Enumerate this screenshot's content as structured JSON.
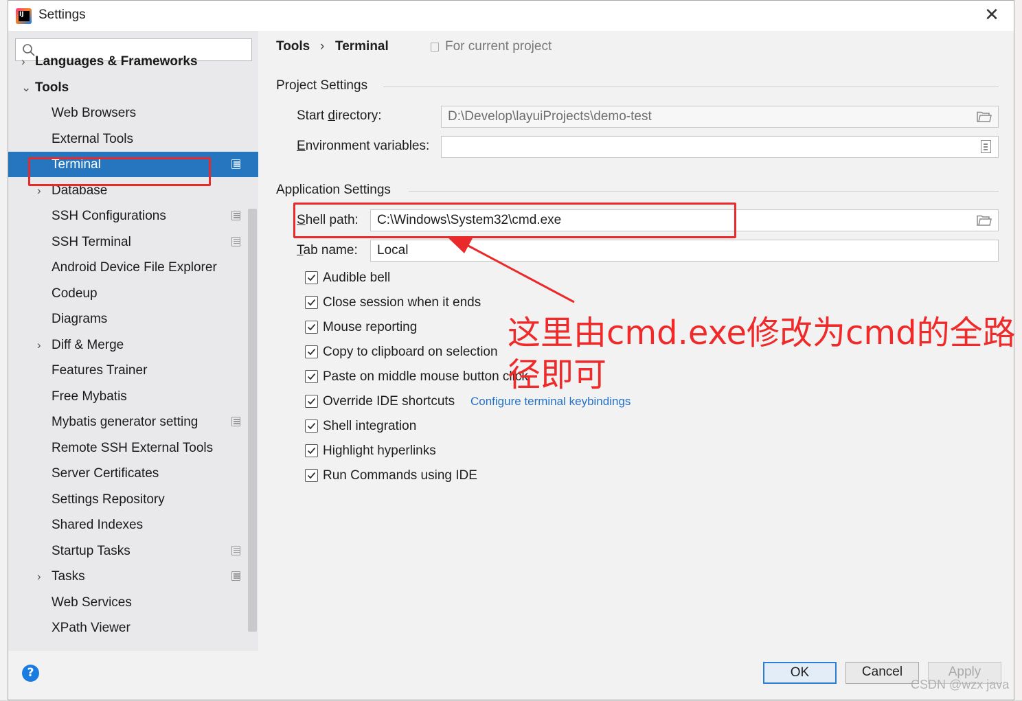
{
  "window": {
    "title": "Settings",
    "close_symbol": "✕"
  },
  "search": {
    "placeholder": ""
  },
  "sidebar": {
    "items": [
      {
        "label": "Languages & Frameworks",
        "level": 0,
        "chevron": "›",
        "project_scoped": false,
        "selected": false
      },
      {
        "label": "Tools",
        "level": 0,
        "chevron": "⌄",
        "project_scoped": false,
        "selected": false
      },
      {
        "label": "Web Browsers",
        "level": 1,
        "chevron": "",
        "project_scoped": false,
        "selected": false
      },
      {
        "label": "External Tools",
        "level": 1,
        "chevron": "",
        "project_scoped": false,
        "selected": false
      },
      {
        "label": "Terminal",
        "level": 1,
        "chevron": "",
        "project_scoped": true,
        "selected": true
      },
      {
        "label": "Database",
        "level": 1,
        "chevron": "›",
        "project_scoped": false,
        "selected": false
      },
      {
        "label": "SSH Configurations",
        "level": 1,
        "chevron": "",
        "project_scoped": true,
        "selected": false
      },
      {
        "label": "SSH Terminal",
        "level": 1,
        "chevron": "",
        "project_scoped": true,
        "selected": false
      },
      {
        "label": "Android Device File Explorer",
        "level": 1,
        "chevron": "",
        "project_scoped": false,
        "selected": false
      },
      {
        "label": "Codeup",
        "level": 1,
        "chevron": "",
        "project_scoped": false,
        "selected": false
      },
      {
        "label": "Diagrams",
        "level": 1,
        "chevron": "",
        "project_scoped": false,
        "selected": false
      },
      {
        "label": "Diff & Merge",
        "level": 1,
        "chevron": "›",
        "project_scoped": false,
        "selected": false
      },
      {
        "label": "Features Trainer",
        "level": 1,
        "chevron": "",
        "project_scoped": false,
        "selected": false
      },
      {
        "label": "Free Mybatis",
        "level": 1,
        "chevron": "",
        "project_scoped": false,
        "selected": false
      },
      {
        "label": "Mybatis generator setting",
        "level": 1,
        "chevron": "",
        "project_scoped": true,
        "selected": false
      },
      {
        "label": "Remote SSH External Tools",
        "level": 1,
        "chevron": "",
        "project_scoped": false,
        "selected": false
      },
      {
        "label": "Server Certificates",
        "level": 1,
        "chevron": "",
        "project_scoped": false,
        "selected": false
      },
      {
        "label": "Settings Repository",
        "level": 1,
        "chevron": "",
        "project_scoped": false,
        "selected": false
      },
      {
        "label": "Shared Indexes",
        "level": 1,
        "chevron": "",
        "project_scoped": false,
        "selected": false
      },
      {
        "label": "Startup Tasks",
        "level": 1,
        "chevron": "",
        "project_scoped": true,
        "selected": false
      },
      {
        "label": "Tasks",
        "level": 1,
        "chevron": "›",
        "project_scoped": true,
        "selected": false
      },
      {
        "label": "Web Services",
        "level": 1,
        "chevron": "",
        "project_scoped": false,
        "selected": false
      },
      {
        "label": "XPath Viewer",
        "level": 1,
        "chevron": "",
        "project_scoped": false,
        "selected": false
      }
    ]
  },
  "breadcrumb": {
    "parent": "Tools",
    "separator": "›",
    "current": "Terminal"
  },
  "scope_label": "For current project",
  "project_settings": {
    "title": "Project Settings",
    "start_directory": {
      "label_pre": "Start ",
      "label_mnemonic": "d",
      "label_post": "irectory:",
      "value": "D:\\Develop\\layuiProjects\\demo-test"
    },
    "env_vars": {
      "label_pre": "",
      "label_mnemonic": "E",
      "label_post": "nvironment variables:",
      "value": ""
    }
  },
  "app_settings": {
    "title": "Application Settings",
    "shell_path": {
      "label_pre": "",
      "label_mnemonic": "S",
      "label_post": "hell path:",
      "value": "C:\\Windows\\System32\\cmd.exe"
    },
    "tab_name": {
      "label_pre": "",
      "label_mnemonic": "T",
      "label_post": "ab name:",
      "value": "Local"
    },
    "checkboxes": [
      {
        "label": "Audible bell",
        "checked": true
      },
      {
        "label": "Close session when it ends",
        "checked": true
      },
      {
        "label": "Mouse reporting",
        "checked": true
      },
      {
        "label": "Copy to clipboard on selection",
        "checked": true
      },
      {
        "label": "Paste on middle mouse button click",
        "checked": true
      },
      {
        "label": "Override IDE shortcuts",
        "checked": true
      },
      {
        "label": "Shell integration",
        "checked": true
      },
      {
        "label": "Highlight hyperlinks",
        "checked": true
      },
      {
        "label": "Run Commands using IDE",
        "checked": true
      }
    ],
    "keybindings_link": "Configure terminal keybindings"
  },
  "footer": {
    "help": "?",
    "ok": "OK",
    "cancel": "Cancel",
    "apply": "Apply"
  },
  "annotation": {
    "text": "这里由cmd.exe修改为cmd的全路径即可",
    "color": "#ee2a2a"
  },
  "watermark": "CSDN @wzx java",
  "colors": {
    "selection": "#2675bf",
    "link": "#2470c2",
    "annotation": "#ea2a2a",
    "ok_border": "#2a7fd4"
  }
}
